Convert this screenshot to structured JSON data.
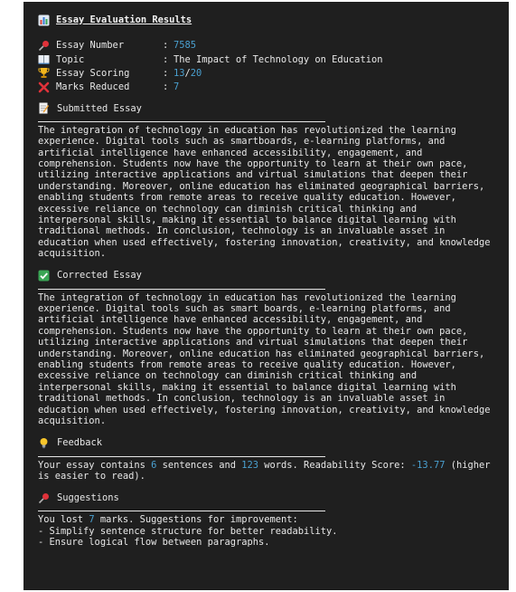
{
  "title": "Essay Evaluation Results",
  "meta": [
    {
      "icon": "pushpin-icon",
      "key": "Essay Number",
      "value": "7585"
    },
    {
      "icon": "book-icon",
      "key": "Topic",
      "value": "The Impact of Technology on Education"
    },
    {
      "icon": "trophy-icon",
      "key": "Essay Scoring",
      "score": "13",
      "score_total": "20"
    },
    {
      "icon": "cross-mark-icon",
      "key": "Marks Reduced",
      "value": "7"
    }
  ],
  "submitted": {
    "heading": "Submitted Essay",
    "lines": [
      "The integration of technology in education has revolutionized the learning",
      "experience. Digital tools such as smartboards, e-learning platforms, and",
      "artificial intelligence have enhanced accessibility, engagement, and",
      "comprehension. Students now have the opportunity to learn at their own pace,",
      "utilizing interactive applications and virtual simulations that deepen their",
      "understanding. Moreover, online education has eliminated geographical barriers,",
      "enabling students from remote areas to receive quality education. However,",
      "excessive reliance on technology can diminish critical thinking and",
      "interpersonal skills, making it essential to balance digital learning with",
      "traditional methods. In conclusion, technology is an invaluable asset in",
      "education when used effectively, fostering innovation, creativity, and knowledge",
      "acquisition."
    ]
  },
  "corrected": {
    "heading": "Corrected Essay",
    "lines": [
      "The integration of technology in education has revolutionized the learning",
      "experience. Digital tools such as smart boards, e-learning platforms, and",
      "artificial intelligence have enhanced accessibility, engagement, and",
      "comprehension. Students now have the opportunity to learn at their own pace,",
      "utilizing interactive applications and virtual simulations that deepen their",
      "understanding. Moreover, online education has eliminated geographical barriers,",
      "enabling students from remote areas to receive quality education. However,",
      "excessive reliance on technology can diminish critical thinking and",
      "interpersonal skills, making it essential to balance digital learning with",
      "traditional methods. In conclusion, technology is an invaluable asset in",
      "education when used effectively, fostering innovation, creativity, and knowledge",
      "acquisition."
    ]
  },
  "feedback": {
    "heading": "Feedback",
    "prefix": "Your essay contains ",
    "sentences": "6",
    "mid1": " sentences and ",
    "words": "123",
    "mid2": " words. Readability Score: ",
    "readability": "-13.77",
    "suffix_line1": " (higher",
    "line2": "is easier to read)."
  },
  "suggestions": {
    "heading": "Suggestions",
    "prefix": "You lost ",
    "lost": "7",
    "suffix": " marks. Suggestions for improvement:",
    "items": [
      "- Simplify sentence structure for better readability.",
      "- Ensure logical flow between paragraphs."
    ]
  },
  "colors": {
    "background": "#1f1f1f",
    "text": "#e8e8e8",
    "number_accent": "#4aa0d0"
  }
}
